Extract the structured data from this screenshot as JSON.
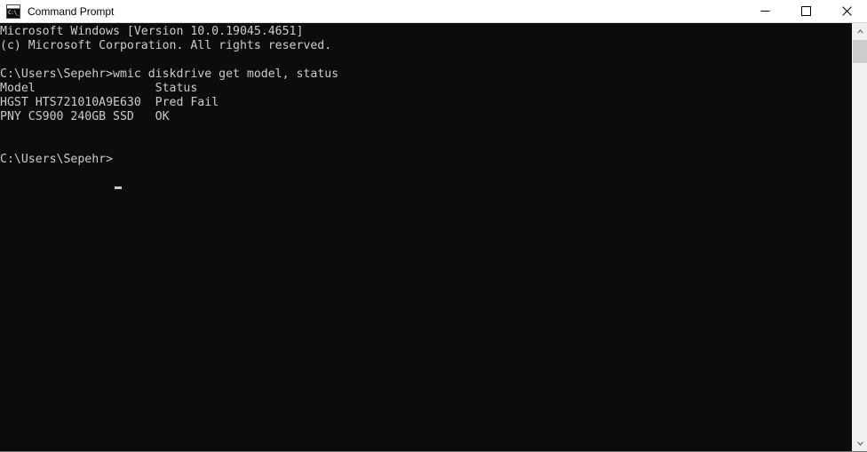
{
  "window": {
    "title": "Command Prompt",
    "icon": "command-prompt-icon",
    "icon_glyph": "C:\\_",
    "colors": {
      "titlebar_background": "#ffffff",
      "titlebar_text": "#000000",
      "console_background": "#0c0c0c",
      "console_text": "#cccccc",
      "scrollbar_track": "#f0f0f0",
      "scrollbar_thumb": "#cdcdcd"
    },
    "controls": [
      {
        "name": "minimize",
        "glyph": "—"
      },
      {
        "name": "maximize",
        "glyph": "□"
      },
      {
        "name": "close",
        "glyph": "✕"
      }
    ]
  },
  "console": {
    "banner": [
      "Microsoft Windows [Version 10.0.19045.4651]",
      "(c) Microsoft Corporation. All rights reserved."
    ],
    "version": "10.0.19045.4651",
    "prompt": "C:\\Users\\Sepehr>",
    "user": "Sepehr",
    "command": "wmic diskdrive get model, status",
    "table": {
      "headers": [
        "Model",
        "Status"
      ],
      "column_offsets": [
        0,
        22
      ],
      "rows": [
        {
          "model": "HGST HTS721010A9E630",
          "status": "Pred Fail"
        },
        {
          "model": "PNY CS900 240GB SSD",
          "status": "OK"
        }
      ]
    },
    "final_prompt": "C:\\Users\\Sepehr>",
    "cursor_visible": true,
    "screen_text": "Microsoft Windows [Version 10.0.19045.4651]\n(c) Microsoft Corporation. All rights reserved.\n\nC:\\Users\\Sepehr>wmic diskdrive get model, status\nModel                 Status\nHGST HTS721010A9E630  Pred Fail\nPNY CS900 240GB SSD   OK\n\n\nC:\\Users\\Sepehr>"
  },
  "scrollbar": {
    "up_arrow": "▲",
    "down_arrow": "▼",
    "thumb_position_percent": 0
  }
}
